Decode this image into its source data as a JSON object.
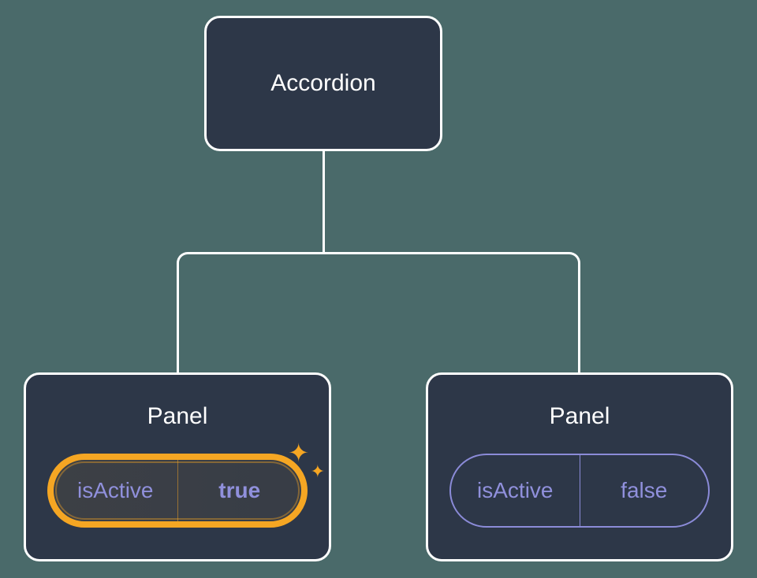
{
  "root": {
    "label": "Accordion"
  },
  "panels": [
    {
      "title": "Panel",
      "property": "isActive",
      "value": "true",
      "active": true
    },
    {
      "title": "Panel",
      "property": "isActive",
      "value": "false",
      "active": false
    }
  ]
}
